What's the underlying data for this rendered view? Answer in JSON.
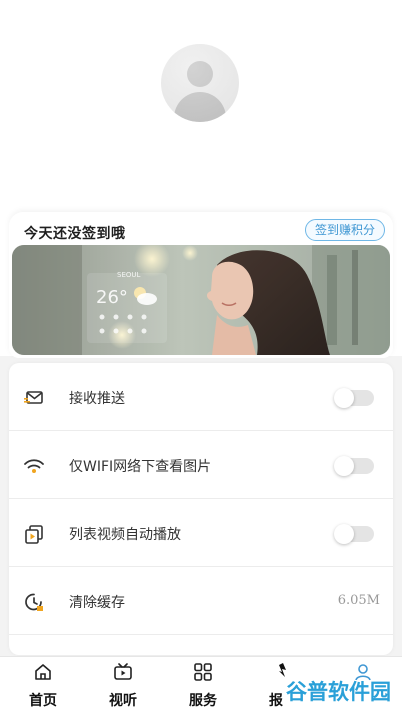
{
  "profile": {
    "avatar_icon": "user-silhouette-icon"
  },
  "signin": {
    "prompt": "今天还没签到哦",
    "button_label": "签到赚积分",
    "accent": "#3f97d3"
  },
  "banner": {
    "weather_city": "SEOUL",
    "weather_temp": "26°",
    "weather_icon": "partly-cloudy-icon"
  },
  "settings": {
    "items": [
      {
        "label": "接收推送",
        "icon": "envelope-icon",
        "toggle_on": false
      },
      {
        "label": "仅WIFI网络下查看图片",
        "icon": "wifi-icon",
        "toggle_on": false
      },
      {
        "label": "列表视频自动播放",
        "icon": "video-play-icon",
        "toggle_on": false
      },
      {
        "label": "清除缓存",
        "icon": "clock-clear-icon",
        "value": "6.05M"
      }
    ]
  },
  "tabbar": {
    "tabs": [
      {
        "label": "首页",
        "icon": "home-icon"
      },
      {
        "label": "视听",
        "icon": "tv-play-icon"
      },
      {
        "label": "服务",
        "icon": "grid-icon"
      },
      {
        "label": "报",
        "icon": "newspaper-icon"
      },
      {
        "label": "我的",
        "icon": "user-icon"
      }
    ]
  },
  "watermark": {
    "text": "谷普软件园"
  }
}
